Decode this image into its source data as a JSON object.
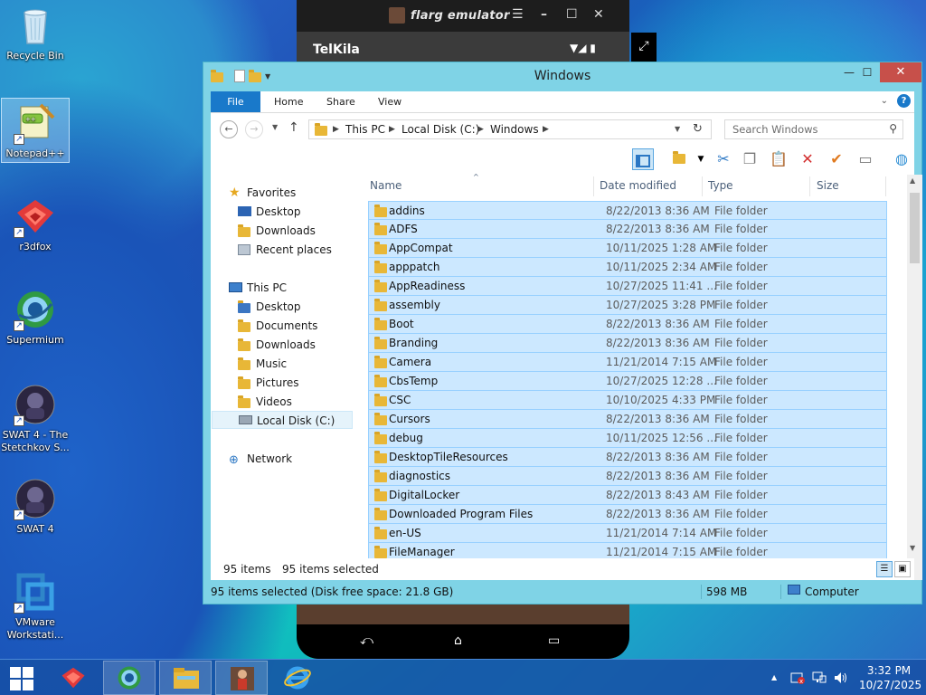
{
  "desktop": {
    "icons": [
      {
        "label": "Recycle Bin"
      },
      {
        "label": "Notepad++"
      },
      {
        "label": "r3dfox"
      },
      {
        "label": "Supermium"
      },
      {
        "label": "SWAT 4 - The Stetchkov S..."
      },
      {
        "label": "SWAT 4"
      },
      {
        "label": "VMware Workstati..."
      }
    ]
  },
  "emulator": {
    "title": "flarg emulator",
    "app_name": "TelKila",
    "controls": {
      "menu": "☰",
      "minimize": "–",
      "maximize": "☐",
      "close": "✕"
    },
    "status_icons": "▼◢ ▮",
    "nav": {
      "back": "⤺",
      "home": "⌂",
      "recents": "▭"
    }
  },
  "window": {
    "title": "Windows",
    "controls": {
      "minimize": "—",
      "maximize": "☐",
      "close": "✕"
    },
    "ribbon_tabs": [
      "File",
      "Home",
      "Share",
      "View"
    ],
    "address": {
      "crumbs": [
        "This PC",
        "Local Disk (C:)",
        "Windows"
      ],
      "search_placeholder": "Search Windows"
    },
    "nav_pane": {
      "favorites": "Favorites",
      "favorites_items": [
        "Desktop",
        "Downloads",
        "Recent places"
      ],
      "this_pc": "This PC",
      "this_pc_items": [
        "Desktop",
        "Documents",
        "Downloads",
        "Music",
        "Pictures",
        "Videos",
        "Local Disk (C:)"
      ],
      "network": "Network"
    },
    "columns": {
      "name": "Name",
      "date": "Date modified",
      "type": "Type",
      "size": "Size"
    },
    "files": [
      {
        "name": "addins",
        "date": "8/22/2013 8:36 AM",
        "type": "File folder"
      },
      {
        "name": "ADFS",
        "date": "8/22/2013 8:36 AM",
        "type": "File folder"
      },
      {
        "name": "AppCompat",
        "date": "10/11/2025 1:28 AM",
        "type": "File folder"
      },
      {
        "name": "apppatch",
        "date": "10/11/2025 2:34 AM",
        "type": "File folder"
      },
      {
        "name": "AppReadiness",
        "date": "10/27/2025 11:41 ...",
        "type": "File folder"
      },
      {
        "name": "assembly",
        "date": "10/27/2025 3:28 PM",
        "type": "File folder"
      },
      {
        "name": "Boot",
        "date": "8/22/2013 8:36 AM",
        "type": "File folder"
      },
      {
        "name": "Branding",
        "date": "8/22/2013 8:36 AM",
        "type": "File folder"
      },
      {
        "name": "Camera",
        "date": "11/21/2014 7:15 AM",
        "type": "File folder"
      },
      {
        "name": "CbsTemp",
        "date": "10/27/2025 12:28 ...",
        "type": "File folder"
      },
      {
        "name": "CSC",
        "date": "10/10/2025 4:33 PM",
        "type": "File folder"
      },
      {
        "name": "Cursors",
        "date": "8/22/2013 8:36 AM",
        "type": "File folder"
      },
      {
        "name": "debug",
        "date": "10/11/2025 12:56 ...",
        "type": "File folder"
      },
      {
        "name": "DesktopTileResources",
        "date": "8/22/2013 8:36 AM",
        "type": "File folder"
      },
      {
        "name": "diagnostics",
        "date": "8/22/2013 8:36 AM",
        "type": "File folder"
      },
      {
        "name": "DigitalLocker",
        "date": "8/22/2013 8:43 AM",
        "type": "File folder"
      },
      {
        "name": "Downloaded Program Files",
        "date": "8/22/2013 8:36 AM",
        "type": "File folder"
      },
      {
        "name": "en-US",
        "date": "11/21/2014 7:14 AM",
        "type": "File folder"
      },
      {
        "name": "FileManager",
        "date": "11/21/2014 7:15 AM",
        "type": "File folder"
      }
    ],
    "status": {
      "items": "95 items",
      "selected": "95 items selected"
    },
    "details_bar": {
      "info": "95 items selected (Disk free space: 21.8 GB)",
      "size": "598 MB",
      "location": "Computer"
    }
  },
  "taskbar": {
    "clock_time": "3:32 PM",
    "clock_date": "10/27/2025",
    "tray_chevron": "▲"
  },
  "colors": {
    "accent": "#1979ca",
    "window_frame": "#7fd3e6",
    "selection": "#cce8ff",
    "close_button": "#c7504a"
  }
}
